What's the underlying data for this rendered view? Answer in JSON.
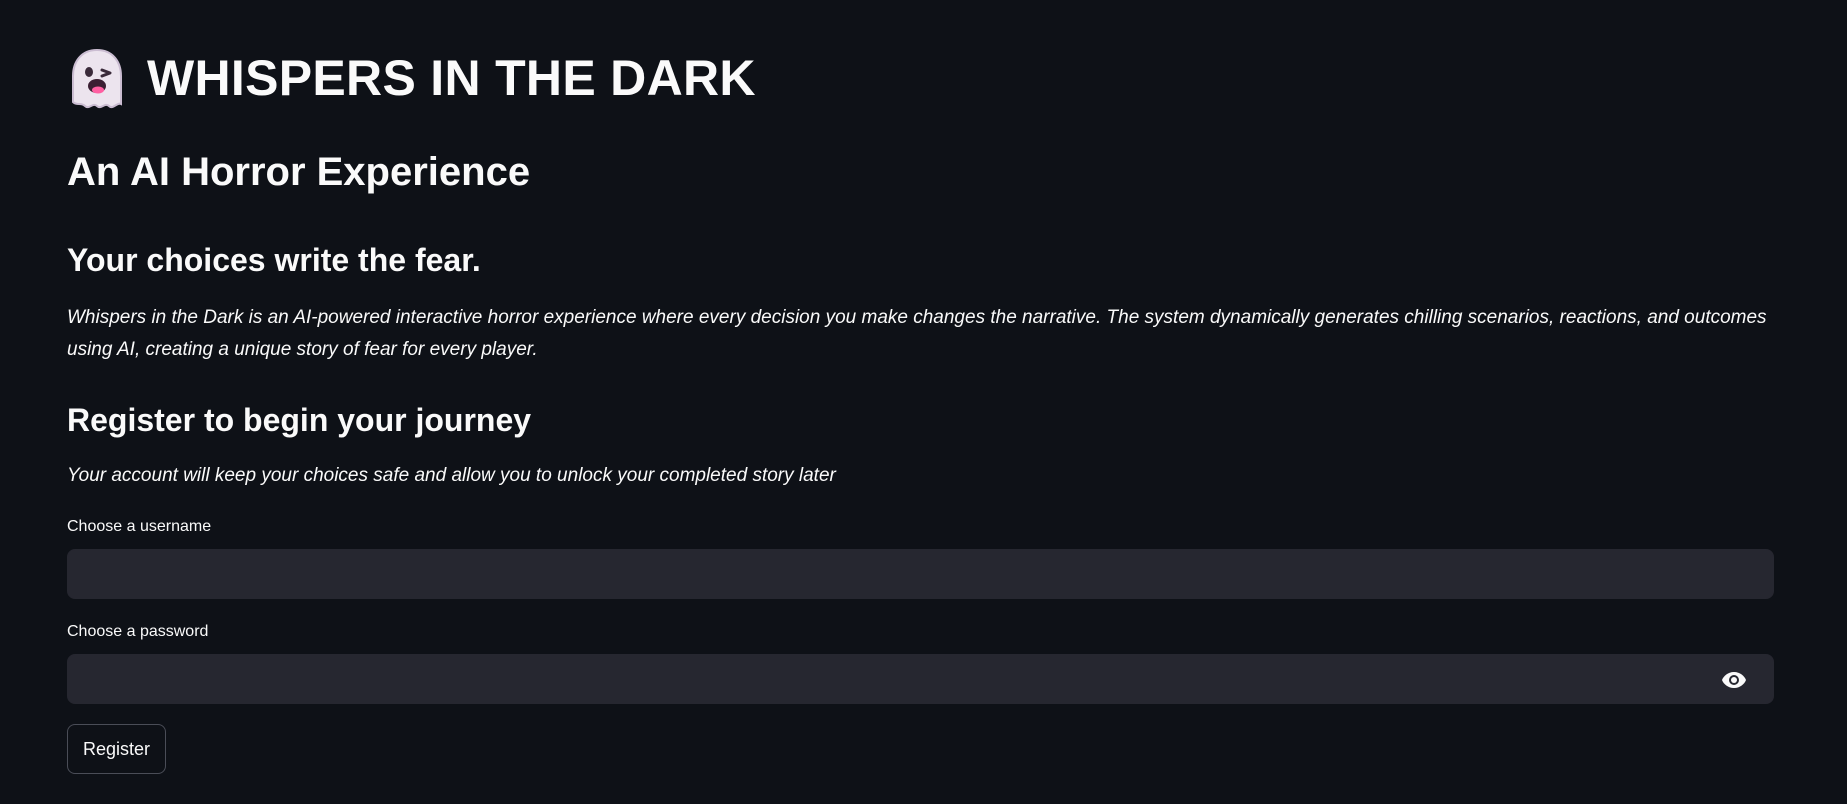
{
  "header": {
    "icon": "ghost-icon",
    "title": "WHISPERS IN THE DARK"
  },
  "intro": {
    "subtitle": "An AI Horror Experience",
    "tagline": "Your choices write the fear.",
    "description": "Whispers in the Dark is an AI-powered interactive horror experience where every decision you make changes the narrative. The system dynamically generates chilling scenarios, reactions, and outcomes using AI, creating a unique story of fear for every player."
  },
  "register": {
    "heading": "Register to begin your journey",
    "note": "Your account will keep your choices safe and allow you to unlock your completed story later",
    "username_label": "Choose a username",
    "username_value": "",
    "password_label": "Choose a password",
    "password_value": "",
    "password_toggle_icon": "eye-icon",
    "button_label": "Register"
  },
  "colors": {
    "background": "#0e1117",
    "input_background": "#262730",
    "text": "#fafafa",
    "button_border": "#4a4d57"
  }
}
